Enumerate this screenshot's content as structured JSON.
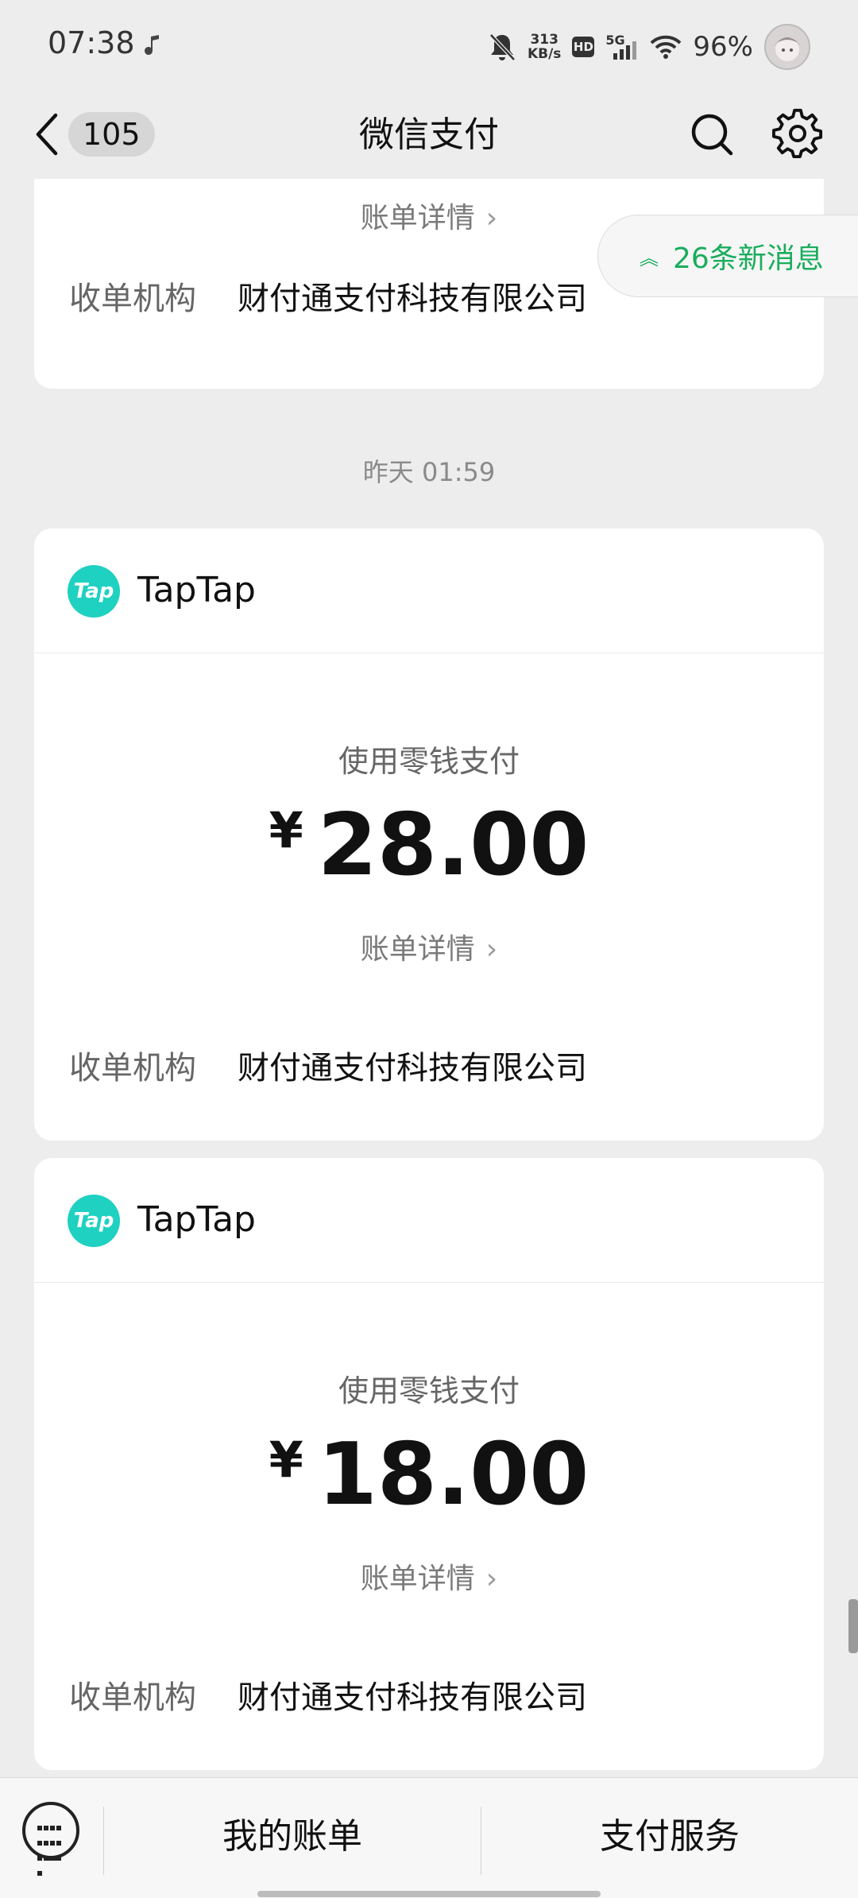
{
  "status_bar": {
    "time": "07:38",
    "net_speed_value": "313",
    "net_speed_unit": "KB/s",
    "hd_label": "HD",
    "network_label": "5G",
    "battery": "96%",
    "icons": [
      "music-note-icon",
      "bell-muted-icon",
      "hd-icon",
      "signal-5g-icon",
      "wifi-icon",
      "avatar"
    ]
  },
  "nav": {
    "unread_count": "105",
    "title": "微信支付",
    "icons": [
      "back-chevron-icon",
      "search-icon",
      "gear-icon"
    ]
  },
  "top_card": {
    "detail_label": "账单详情",
    "merchant_label": "收单机构",
    "merchant_value": "财付通支付科技有限公司"
  },
  "new_messages": "26条新消息",
  "timestamp": "昨天 01:59",
  "payments": [
    {
      "app_logo_text": "Tap",
      "app_name": "TapTap",
      "method": "使用零钱支付",
      "currency": "¥",
      "amount": "28.00",
      "detail_label": "账单详情",
      "merchant_label": "收单机构",
      "merchant_value": "财付通支付科技有限公司"
    },
    {
      "app_logo_text": "Tap",
      "app_name": "TapTap",
      "method": "使用零钱支付",
      "currency": "¥",
      "amount": "18.00",
      "detail_label": "账单详情",
      "merchant_label": "收单机构",
      "merchant_value": "财付通支付科技有限公司"
    }
  ],
  "bottom_bar": {
    "items": [
      "我的账单",
      "支付服务"
    ]
  },
  "colors": {
    "background": "#ededed",
    "card": "#ffffff",
    "accent_green": "#1aad5c",
    "taptap_teal": "#1fd1c1"
  }
}
